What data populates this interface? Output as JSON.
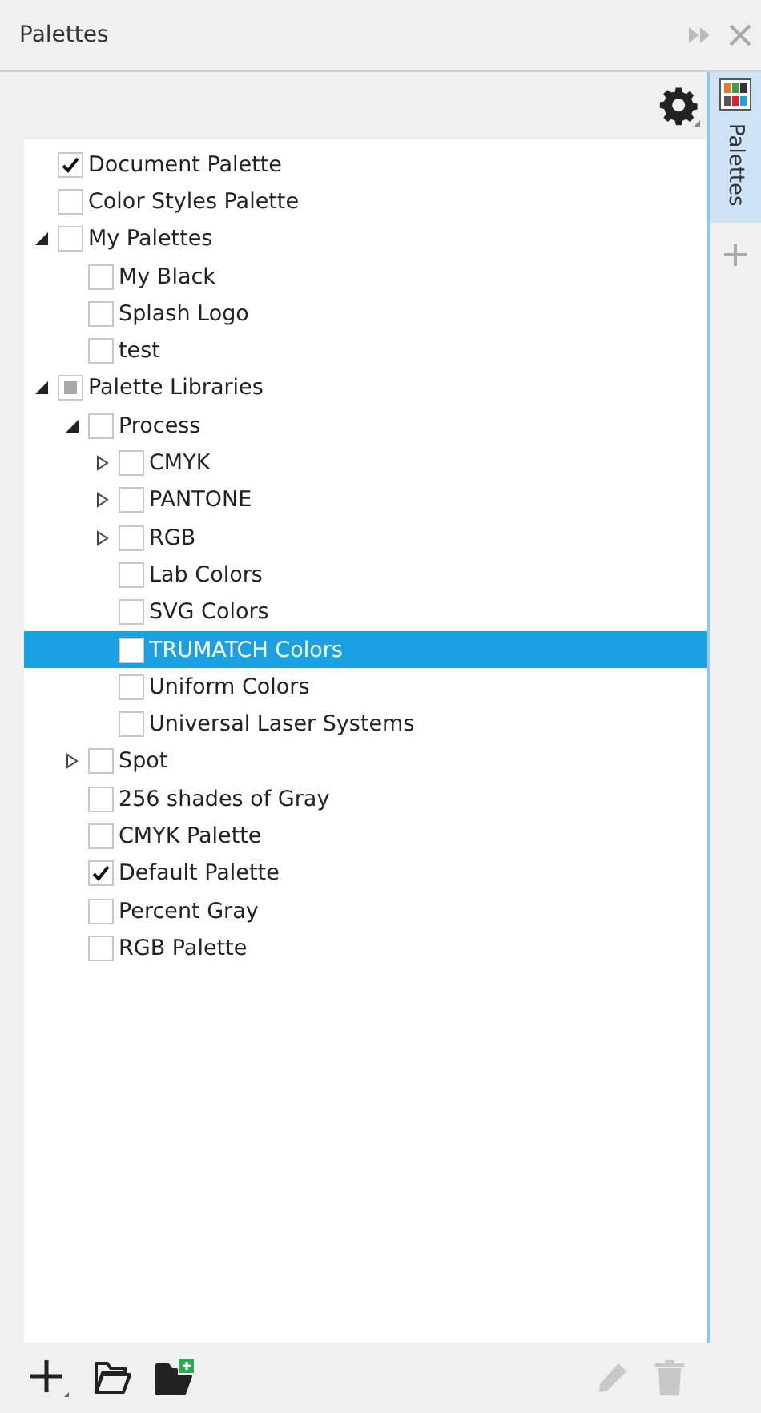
{
  "window": {
    "title": "Palettes"
  },
  "side_tabs": [
    {
      "label": "Palettes",
      "selected": true
    }
  ],
  "tree": [
    {
      "label": "Document Palette",
      "checked": true,
      "selected": false
    },
    {
      "label": "Color Styles Palette",
      "checked": false,
      "selected": false
    },
    {
      "label": "My Palettes",
      "checked": false,
      "selected": false,
      "expanded": true,
      "children": [
        {
          "label": "My Black",
          "checked": false,
          "selected": false
        },
        {
          "label": "Splash Logo",
          "checked": false,
          "selected": false
        },
        {
          "label": "test",
          "checked": false,
          "selected": false
        }
      ]
    },
    {
      "label": "Palette Libraries",
      "checked": false,
      "mixed": true,
      "selected": false,
      "expanded": true,
      "children": [
        {
          "label": "Process",
          "checked": false,
          "selected": false,
          "expanded": true,
          "children": [
            {
              "label": "CMYK",
              "checked": false,
              "selected": false,
              "expanded": false
            },
            {
              "label": "PANTONE",
              "checked": false,
              "selected": false,
              "expanded": false
            },
            {
              "label": "RGB",
              "checked": false,
              "selected": false,
              "expanded": false
            },
            {
              "label": "Lab Colors",
              "checked": false,
              "selected": false
            },
            {
              "label": "SVG Colors",
              "checked": false,
              "selected": false
            },
            {
              "label": "TRUMATCH Colors",
              "checked": false,
              "selected": true
            },
            {
              "label": "Uniform Colors",
              "checked": false,
              "selected": false
            },
            {
              "label": "Universal Laser Systems",
              "checked": false,
              "selected": false
            }
          ]
        },
        {
          "label": "Spot",
          "checked": false,
          "selected": false,
          "expanded": false
        },
        {
          "label": "256 shades of Gray",
          "checked": false,
          "selected": false
        },
        {
          "label": "CMYK Palette",
          "checked": false,
          "selected": false
        },
        {
          "label": "Default Palette",
          "checked": true,
          "selected": false
        },
        {
          "label": "Percent Gray",
          "checked": false,
          "selected": false
        },
        {
          "label": "RGB Palette",
          "checked": false,
          "selected": false
        }
      ]
    }
  ],
  "footer": {
    "edit_disabled": true,
    "delete_disabled": true
  }
}
